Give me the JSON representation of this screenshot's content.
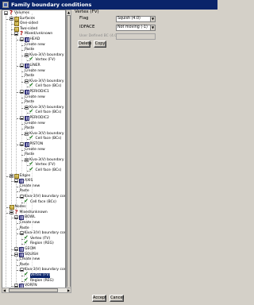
{
  "window": {
    "title": "Family boundary conditions"
  },
  "tree": [
    {
      "label": "Volumes",
      "indent": 0,
      "icon": "question-mark-icon",
      "toggle": true
    },
    {
      "label": "Surfaces",
      "indent": 1,
      "icon": "folder-icon",
      "toggle": true
    },
    {
      "label": "One-sided",
      "indent": 2,
      "icon": "folder-icon",
      "toggle": false
    },
    {
      "label": "Two-sided",
      "indent": 2,
      "icon": "folder-icon",
      "toggle": false
    },
    {
      "label": "Mixed/unknown",
      "indent": 2,
      "icon": "question-mark-icon",
      "toggle": true
    },
    {
      "label": "HEAD",
      "indent": 3,
      "icon": "mesh-icon",
      "toggle": true
    },
    {
      "label": "Create new",
      "indent": 4,
      "icon": "none",
      "toggle": false
    },
    {
      "label": "Paste",
      "indent": 4,
      "icon": "none",
      "toggle": false
    },
    {
      "label": "Kiva-3(V) boundary conditions",
      "indent": 4,
      "icon": "none",
      "toggle": true
    },
    {
      "label": "Vertex (FV)",
      "indent": 5,
      "icon": "check-icon",
      "toggle": false
    },
    {
      "label": "LINER",
      "indent": 3,
      "icon": "mesh-icon",
      "toggle": true
    },
    {
      "label": "Create new",
      "indent": 4,
      "icon": "none",
      "toggle": false
    },
    {
      "label": "Paste",
      "indent": 4,
      "icon": "none",
      "toggle": false
    },
    {
      "label": "Kiva-3(V) boundary conditions",
      "indent": 4,
      "icon": "none",
      "toggle": true
    },
    {
      "label": "Cell face (BCs)",
      "indent": 5,
      "icon": "check-icon",
      "toggle": false
    },
    {
      "label": "PERIODIC1",
      "indent": 3,
      "icon": "mesh-icon",
      "toggle": true
    },
    {
      "label": "Create new",
      "indent": 4,
      "icon": "none",
      "toggle": false
    },
    {
      "label": "Paste",
      "indent": 4,
      "icon": "none",
      "toggle": false
    },
    {
      "label": "Kiva-3(V) boundary conditions",
      "indent": 4,
      "icon": "none",
      "toggle": true
    },
    {
      "label": "Cell face (BCs)",
      "indent": 5,
      "icon": "check-icon",
      "toggle": false
    },
    {
      "label": "PERIODIC2",
      "indent": 3,
      "icon": "mesh-icon",
      "toggle": true
    },
    {
      "label": "Create new",
      "indent": 4,
      "icon": "none",
      "toggle": false
    },
    {
      "label": "Paste",
      "indent": 4,
      "icon": "none",
      "toggle": false
    },
    {
      "label": "Kiva-3(V) boundary conditions",
      "indent": 4,
      "icon": "none",
      "toggle": true
    },
    {
      "label": "Cell face (BCs)",
      "indent": 5,
      "icon": "check-icon",
      "toggle": false
    },
    {
      "label": "PISTON",
      "indent": 3,
      "icon": "mesh-icon",
      "toggle": true
    },
    {
      "label": "Create new",
      "indent": 4,
      "icon": "none",
      "toggle": false
    },
    {
      "label": "Paste",
      "indent": 4,
      "icon": "none",
      "toggle": false
    },
    {
      "label": "Kiva-3(V) boundary conditions",
      "indent": 4,
      "icon": "none",
      "toggle": true
    },
    {
      "label": "Vertex (FV)",
      "indent": 5,
      "icon": "check-icon",
      "toggle": false
    },
    {
      "label": "Cell face (BCs)",
      "indent": 5,
      "icon": "check-icon",
      "toggle": false
    },
    {
      "label": "Edges",
      "indent": 1,
      "icon": "folder-icon",
      "toggle": true
    },
    {
      "label": "AXIS",
      "indent": 2,
      "icon": "mesh-icon",
      "toggle": true
    },
    {
      "label": "Create new",
      "indent": 3,
      "icon": "none",
      "toggle": false
    },
    {
      "label": "Paste",
      "indent": 3,
      "icon": "none",
      "toggle": false
    },
    {
      "label": "Kiva-3(V) boundary conditions",
      "indent": 3,
      "icon": "none",
      "toggle": true
    },
    {
      "label": "Cell face (BCs)",
      "indent": 4,
      "icon": "check-icon",
      "toggle": false
    },
    {
      "label": "Nodes",
      "indent": 1,
      "icon": "folder-icon",
      "toggle": false
    },
    {
      "label": "Mixed/unknown",
      "indent": 1,
      "icon": "question-mark-icon",
      "toggle": true
    },
    {
      "label": "BOWL",
      "indent": 2,
      "icon": "mesh-icon",
      "toggle": true
    },
    {
      "label": "Create new",
      "indent": 3,
      "icon": "none",
      "toggle": false
    },
    {
      "label": "Paste",
      "indent": 3,
      "icon": "none",
      "toggle": false
    },
    {
      "label": "Kiva-3(V) boundary conditions",
      "indent": 3,
      "icon": "none",
      "toggle": true
    },
    {
      "label": "Vertex (FV)",
      "indent": 4,
      "icon": "check-icon",
      "toggle": false
    },
    {
      "label": "Region (REG)",
      "indent": 4,
      "icon": "check-icon",
      "toggle": false
    },
    {
      "label": "GEOM",
      "indent": 2,
      "icon": "mesh-icon",
      "toggle": true
    },
    {
      "label": "SQUISH",
      "indent": 2,
      "icon": "mesh-icon",
      "toggle": true
    },
    {
      "label": "Create new",
      "indent": 3,
      "icon": "none",
      "toggle": false
    },
    {
      "label": "Paste",
      "indent": 3,
      "icon": "none",
      "toggle": false
    },
    {
      "label": "Kiva-3(V) boundary conditions",
      "indent": 3,
      "icon": "none",
      "toggle": true
    },
    {
      "label": "Vertex (FV)",
      "indent": 4,
      "icon": "check-icon",
      "toggle": false,
      "selected": true
    },
    {
      "label": "Region (REG)",
      "indent": 4,
      "icon": "check-icon",
      "toggle": false
    },
    {
      "label": "VORFN",
      "indent": 2,
      "icon": "mesh-icon",
      "toggle": true
    }
  ],
  "panel": {
    "heading": "Vertex (FV)",
    "flag_label": "Flag",
    "flag_value": "Squish (4.0)",
    "idface_label": "IDFACE",
    "idface_value": "Not moving (-1)",
    "user_defined_label": "User Defined BC (4.0)",
    "delete_label": "Delete",
    "copy_label": "Copy"
  },
  "footer": {
    "accept_label": "Accept",
    "cancel_label": "Cancel"
  },
  "colors": {
    "titlebar": "#0a246a",
    "selection": "#0a246a",
    "check": "#1a7a1a"
  }
}
